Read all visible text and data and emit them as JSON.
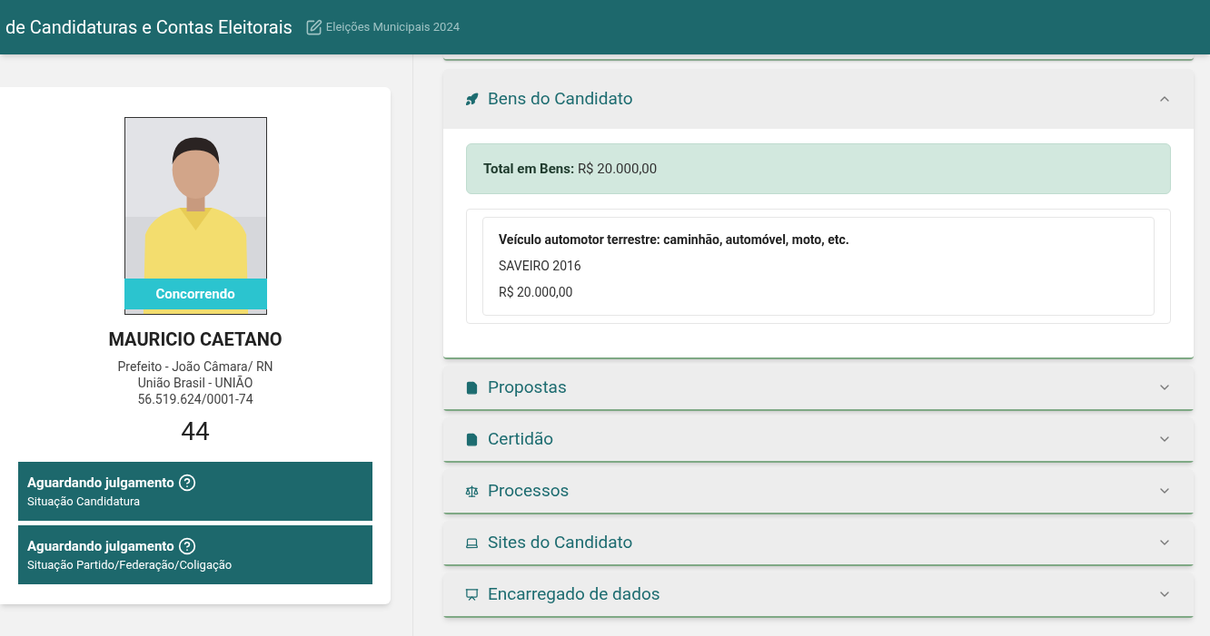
{
  "header": {
    "title": "de Candidaturas e Contas Eleitorais",
    "subtitle": "Eleições Municipais 2024"
  },
  "candidate": {
    "status_badge": "Concorrendo",
    "name": "MAURICIO CAETANO",
    "office": "Prefeito - João Câmara/ RN",
    "party": "União Brasil - UNIÃO",
    "cnpj": "56.519.624/0001-74",
    "number": "44",
    "situations": [
      {
        "value": "Aguardando julgamento",
        "label": "Situação Candidatura"
      },
      {
        "value": "Aguardando julgamento",
        "label": "Situação Partido/Federação/Coligação"
      }
    ]
  },
  "sections": [
    {
      "title": "Bens do Candidato",
      "expanded": true,
      "total_label": "Total em Bens:",
      "total_value": "R$ 20.000,00",
      "items": [
        {
          "type": "Veículo automotor terrestre: caminhão, automóvel, moto, etc.",
          "description": "SAVEIRO 2016",
          "value": "R$ 20.000,00"
        }
      ]
    },
    {
      "title": "Propostas",
      "expanded": false
    },
    {
      "title": "Certidão",
      "expanded": false
    },
    {
      "title": "Processos",
      "expanded": false
    },
    {
      "title": "Sites do Candidato",
      "expanded": false
    },
    {
      "title": "Encarregado de dados",
      "expanded": false
    }
  ]
}
